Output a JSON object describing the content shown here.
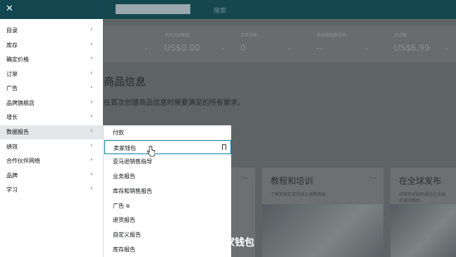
{
  "topbar": {
    "search_text": "搜索"
  },
  "metrics": [
    {
      "label": "",
      "value": ""
    },
    {
      "label": "今天的销售额",
      "value": "US$0.00"
    },
    {
      "label": "买家消息",
      "value": "0"
    },
    {
      "label": "购买按钮赢得率",
      "value": "--"
    },
    {
      "label": "总余额",
      "value": "US$6.99"
    }
  ],
  "background": {
    "headline": "商品信息",
    "subline": "在首次创建商品信息时需要满足的所有要求。",
    "cards": [
      {
        "title": "",
        "desc": ""
      },
      {
        "title": "教程和培训",
        "desc": "了解如何在亚马逊上销售商品"
      },
      {
        "title": "在全球发布",
        "desc": "获取有关如何通过在全球\n买家的帮助"
      }
    ]
  },
  "nav": {
    "close_label": "✕",
    "items": [
      {
        "label": "目录"
      },
      {
        "label": "库存"
      },
      {
        "label": "确定价格"
      },
      {
        "label": "订单"
      },
      {
        "label": "广告"
      },
      {
        "label": "品牌旗舰店"
      },
      {
        "label": "增长"
      },
      {
        "label": "数据报告"
      },
      {
        "label": "绩效"
      },
      {
        "label": "合作伙伴网络"
      },
      {
        "label": "品牌"
      },
      {
        "label": "学习"
      }
    ]
  },
  "submenu": {
    "items": [
      {
        "label": "付款"
      },
      {
        "label": "卖家钱包"
      },
      {
        "label": "亚马逊销售指导"
      },
      {
        "label": "业务报告"
      },
      {
        "label": "库存和销售报告"
      },
      {
        "label": "广告"
      },
      {
        "label": "退货报告"
      },
      {
        "label": "自定义报告"
      },
      {
        "label": "库存报告"
      }
    ]
  },
  "caption": "访问卖家钱包",
  "icons": {
    "close": "close-icon",
    "chevron": "chevron-right-icon",
    "bookmark": "bookmark-icon",
    "external": "external-link-icon",
    "cursor": "hand-cursor-icon"
  },
  "colors": {
    "nav_header": "#12474f",
    "selected_border": "#0a7bb0"
  }
}
